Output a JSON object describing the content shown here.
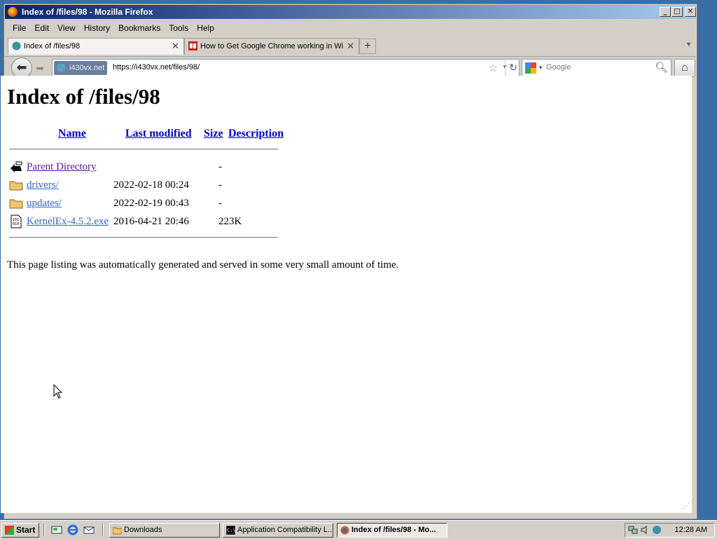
{
  "window": {
    "title": "Index of /files/98 - Mozilla Firefox",
    "controls": {
      "minimize": "_",
      "maximize": "□",
      "close": "✕"
    }
  },
  "menu": [
    "File",
    "Edit",
    "View",
    "History",
    "Bookmarks",
    "Tools",
    "Help"
  ],
  "tabs": [
    {
      "label": "Index of /files/98",
      "active": true
    },
    {
      "label": "How to Get Google Chrome working in Wi...",
      "active": false
    }
  ],
  "nav": {
    "identity": "i430vx.net",
    "url": "https://i430vx.net/files/98/",
    "search_placeholder": "Google"
  },
  "page": {
    "heading": "Index of /files/98",
    "columns": {
      "name": "Name",
      "last_modified": "Last modified",
      "size": "Size",
      "description": "Description"
    },
    "rows": [
      {
        "name": "Parent Directory",
        "date": "",
        "size": "-",
        "icon": "back-icon"
      },
      {
        "name": "drivers/",
        "date": "2022-02-18 00:24",
        "size": "-",
        "icon": "folder-icon"
      },
      {
        "name": "updates/",
        "date": "2022-02-19 00:43",
        "size": "-",
        "icon": "folder-icon"
      },
      {
        "name": "KernelEx-4.5.2.exe",
        "date": "2016-04-21 20:46",
        "size": "223K",
        "icon": "binary-file-icon"
      }
    ],
    "footer": "This page listing was automatically generated and served in some very small amount of time."
  },
  "taskbar": {
    "start": "Start",
    "items": [
      {
        "label": "Downloads",
        "active": false
      },
      {
        "label": "Application Compatibility L...",
        "active": false
      },
      {
        "label": "Index of /files/98 - Mo...",
        "active": true
      }
    ],
    "clock": "12:28 AM"
  }
}
